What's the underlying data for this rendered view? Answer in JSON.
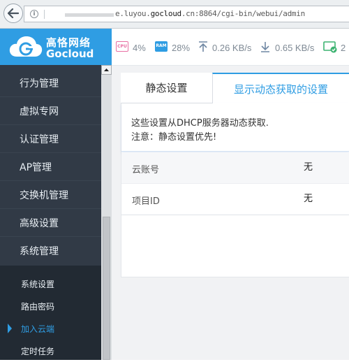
{
  "browser": {
    "url_domain_prefix": "e.luyou.",
    "url_host": "gocloud",
    "url_rest": ".cn:8864/cgi-bin/webui/admin"
  },
  "brand": {
    "name_cn": "高恪网络",
    "name_en": "Gocloud",
    "color": "#2f9de3"
  },
  "status": {
    "cpu_label": "CPU",
    "cpu_value": "4%",
    "ram_label": "RAM",
    "ram_value": "28%",
    "upload_value": "0.26 KB/s",
    "download_value": "0.65 KB/s",
    "online_value": "2",
    "cpu_color": "#e86fa3",
    "ram_color": "#2f9de3",
    "online_color": "#3cb371"
  },
  "sidebar": {
    "items": [
      {
        "label": "行为管理"
      },
      {
        "label": "虚拟专网"
      },
      {
        "label": "认证管理"
      },
      {
        "label": "AP管理"
      },
      {
        "label": "交换机管理"
      },
      {
        "label": "高级设置"
      },
      {
        "label": "系统管理"
      }
    ],
    "submenu": [
      {
        "label": "系统设置"
      },
      {
        "label": "路由密码"
      },
      {
        "label": "加入云端"
      },
      {
        "label": "定时任务"
      }
    ]
  },
  "tabs": {
    "static": "静态设置",
    "dynamic": "显示动态获取的设置"
  },
  "notice": {
    "line1": "这些设置从DHCP服务器动态获取.",
    "line2": "注意：静态设置优先!"
  },
  "rows": [
    {
      "key": "云账号",
      "value": "无"
    },
    {
      "key": "项目ID",
      "value": "无"
    }
  ]
}
